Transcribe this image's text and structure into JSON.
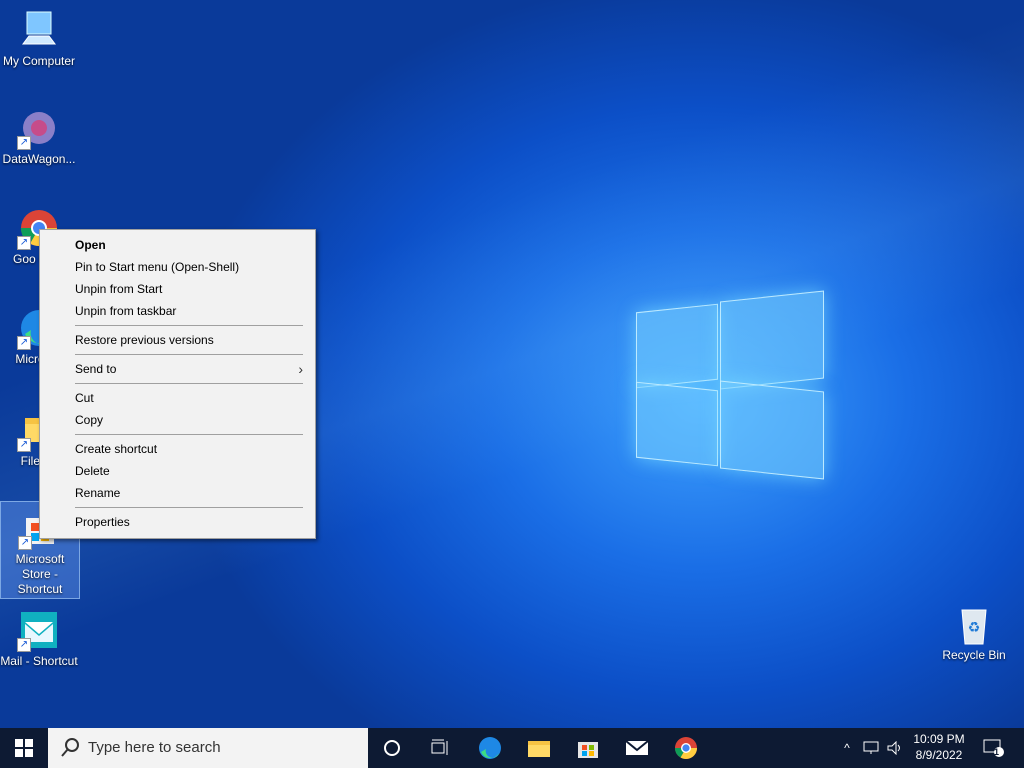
{
  "desktop_icons": [
    {
      "label": "My Computer"
    },
    {
      "label": "DataWagon..."
    },
    {
      "label": "Goo Chro"
    },
    {
      "label": "Micro Ed"
    },
    {
      "label": "File Ex"
    },
    {
      "label": "Microsoft Store - Shortcut"
    },
    {
      "label": "Mail - Shortcut"
    },
    {
      "label": "Recycle Bin"
    }
  ],
  "context_menu": {
    "items": [
      {
        "label": "Open"
      },
      {
        "label": "Pin to Start menu (Open-Shell)"
      },
      {
        "label": "Unpin from Start"
      },
      {
        "label": "Unpin from taskbar"
      },
      {
        "label": "Restore previous versions"
      },
      {
        "label": "Send to"
      },
      {
        "label": "Cut"
      },
      {
        "label": "Copy"
      },
      {
        "label": "Create shortcut"
      },
      {
        "label": "Delete"
      },
      {
        "label": "Rename"
      },
      {
        "label": "Properties"
      }
    ]
  },
  "taskbar": {
    "search_placeholder": "Type here to search",
    "clock_time": "10:09 PM",
    "clock_date": "8/9/2022",
    "notification_count": "1",
    "pinned_apps": [
      "cortana-icon",
      "task-view-icon",
      "edge-icon",
      "file-explorer-icon",
      "microsoft-store-icon",
      "mail-icon",
      "chrome-icon"
    ]
  },
  "colors": {
    "taskbar": "#0d1a33",
    "menu_bg": "#f2f2f2",
    "desktop_accent": "#1a6ee6"
  }
}
